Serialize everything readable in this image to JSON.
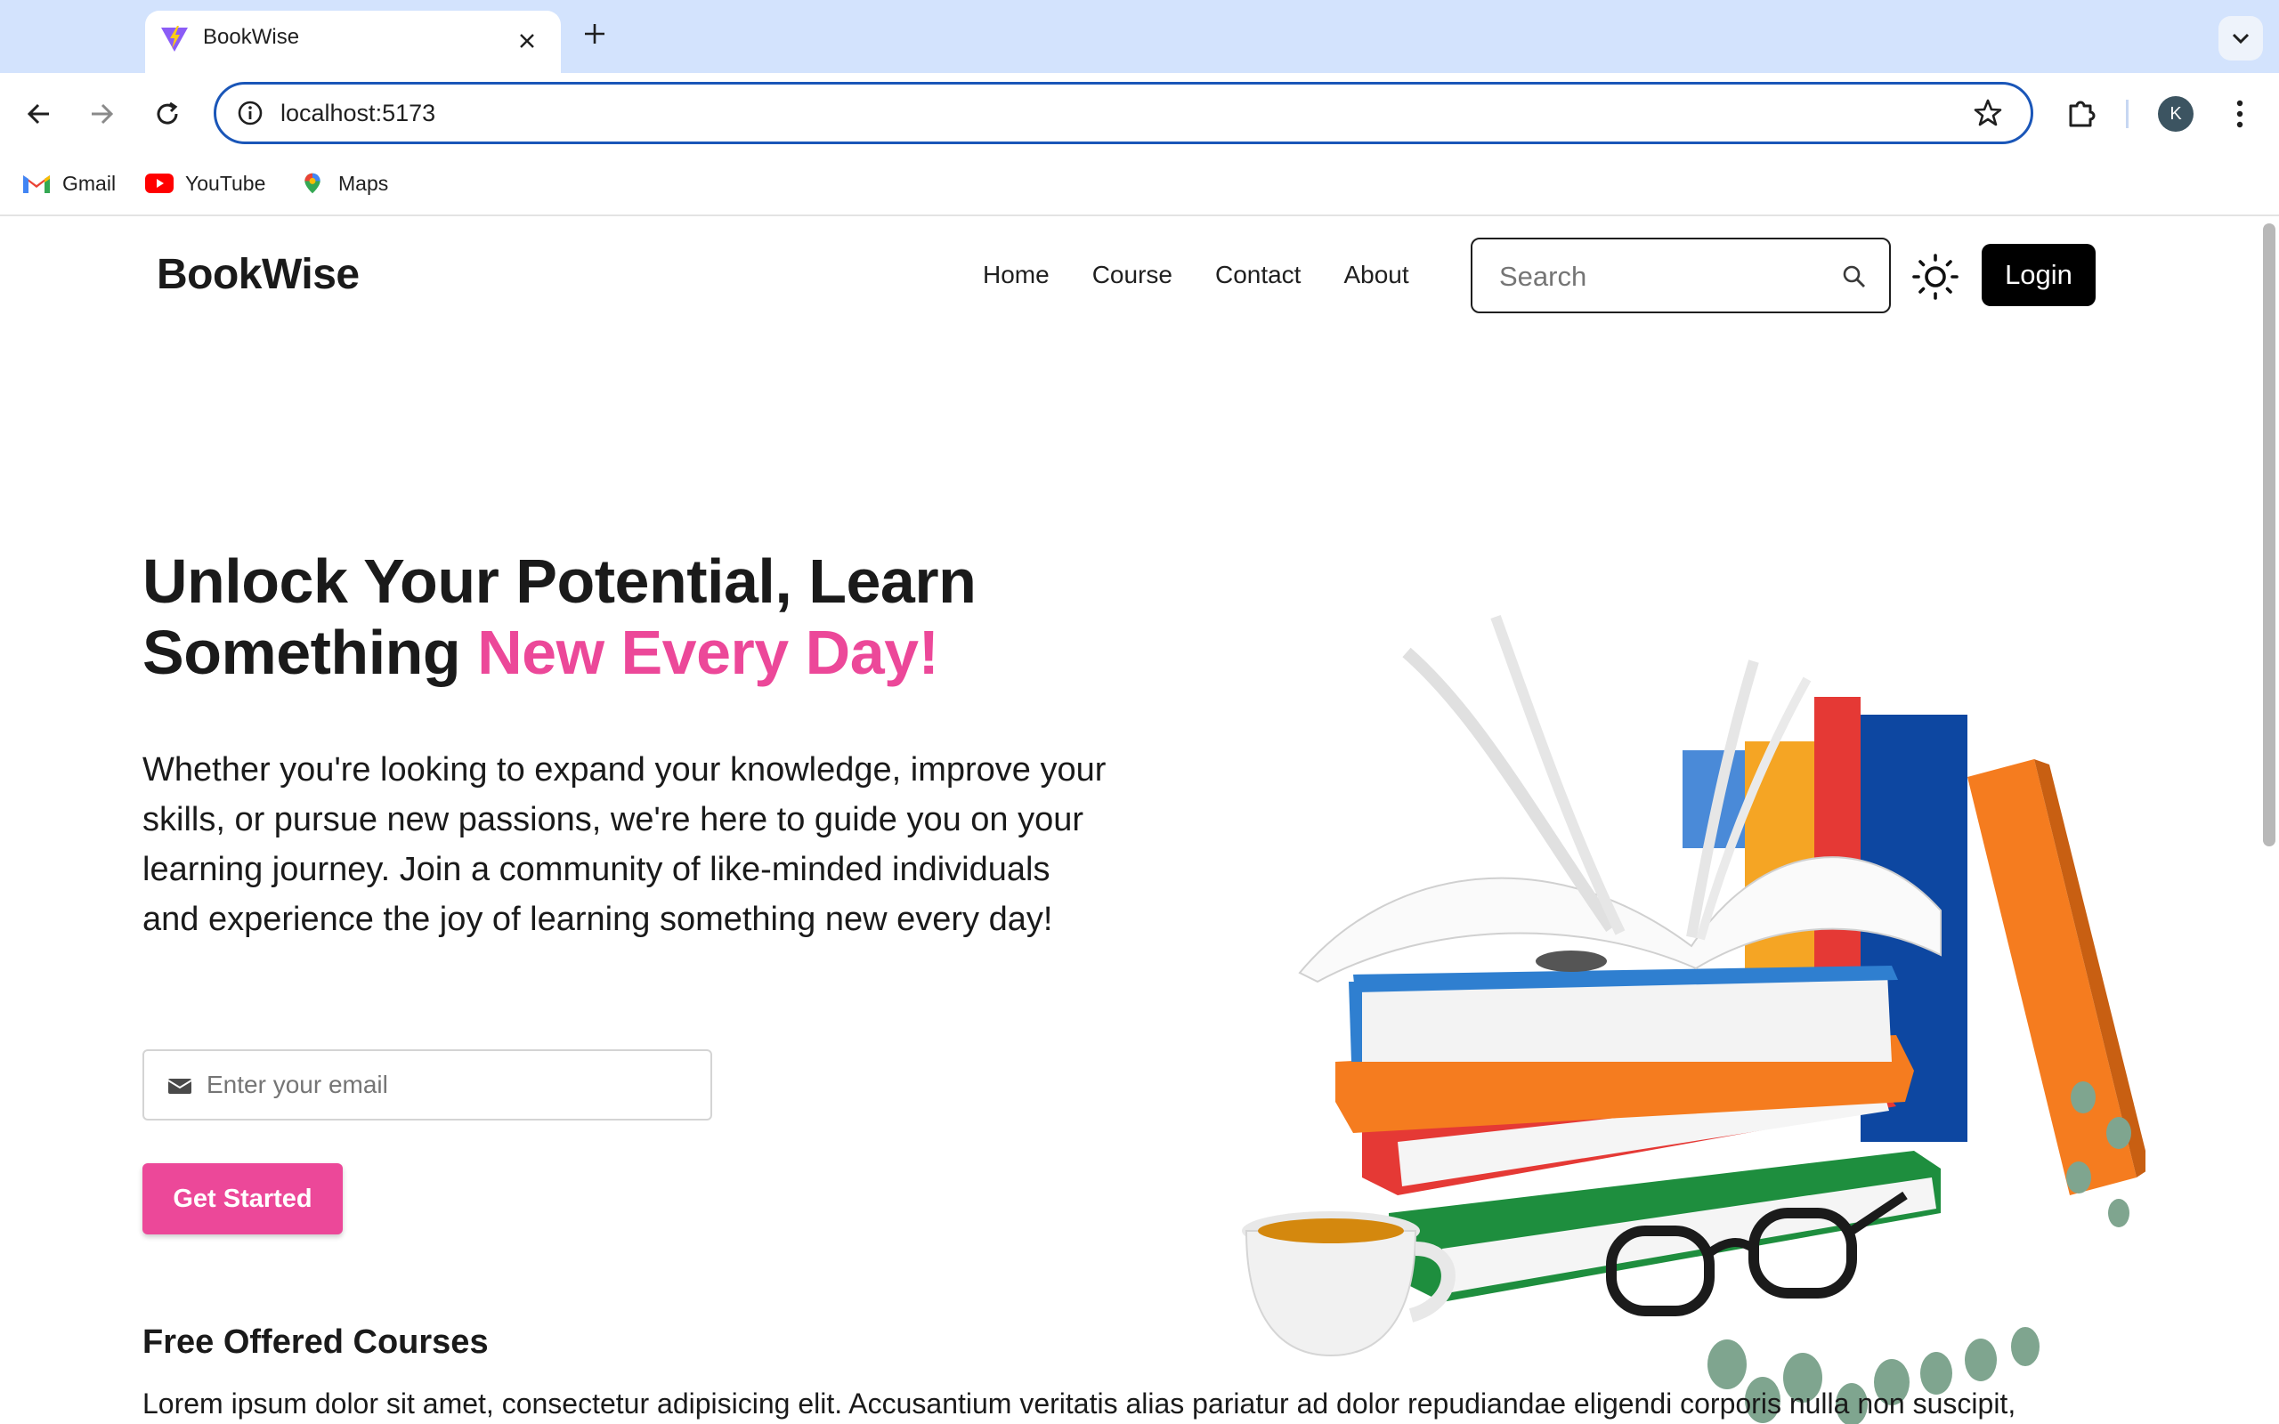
{
  "browser": {
    "tab_title": "BookWise",
    "url": "localhost:5173",
    "profile_initial": "K",
    "bookmarks": [
      {
        "label": "Gmail",
        "icon": "gmail-icon"
      },
      {
        "label": "YouTube",
        "icon": "youtube-icon"
      },
      {
        "label": "Maps",
        "icon": "maps-icon"
      }
    ]
  },
  "site": {
    "brand": "BookWise",
    "nav": [
      "Home",
      "Course",
      "Contact",
      "About"
    ],
    "search_placeholder": "Search",
    "login_label": "Login",
    "accent_color": "#ec4899"
  },
  "hero": {
    "title_part1": "Unlock Your Potential, Learn Something ",
    "title_accent": "New Every Day!",
    "body": "Whether you're looking to expand your knowledge, improve your skills, or pursue new passions, we're here to guide you on your learning journey. Join a community of like-minded individuals and experience the joy of learning something new every day!",
    "email_placeholder": "Enter your email",
    "cta_label": "Get Started"
  },
  "courses": {
    "title": "Free Offered Courses",
    "body": "Lorem ipsum dolor sit amet, consectetur adipisicing elit. Accusantium veritatis alias pariatur ad dolor repudiandae eligendi corporis nulla non suscipit,"
  }
}
